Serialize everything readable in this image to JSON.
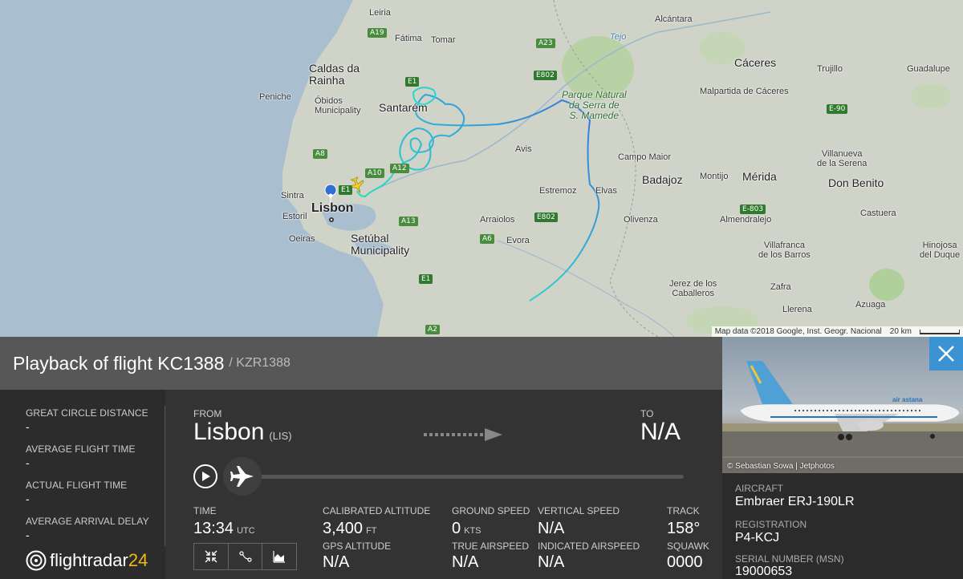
{
  "map": {
    "places": {
      "leiria": "Leiria",
      "fatima": "Fátima",
      "tomar": "Tomar",
      "caldas": "Caldas da\nRainha",
      "peniche": "Peniche",
      "obidos": "Óbidos\nMunicipality",
      "santarem": "Santarém",
      "sintra": "Sintra",
      "estoril": "Estoril",
      "oeiras": "Oeiras",
      "lisbon": "Lisbon",
      "setubal": "Setúbal\nMunicipality",
      "avis": "Avis",
      "estremoz": "Estremoz",
      "arraiolos": "Arraiolos",
      "evora": "Evora",
      "elvas": "Elvas",
      "campo_maior": "Campo Maior",
      "badajoz": "Badajoz",
      "olivenza": "Olivenza",
      "montijo": "Montijo",
      "merida": "Mérida",
      "caceres": "Cáceres",
      "malpartida": "Malpartida de Cáceres",
      "trujillo": "Trujillo",
      "alcantara": "Alcántara",
      "guadalupe": "Guadalupe",
      "villanueva": "Villanueva\nde la Serena",
      "don_benito": "Don Benito",
      "almendralejo": "Almendralejo",
      "castuera": "Castuera",
      "villafranca": "Villafranca\nde los Barros",
      "hinojosa": "Hinojosa\ndel Duque",
      "jerez": "Jerez de los\nCaballeros",
      "llerena": "Llerena",
      "azuaga": "Azuaga",
      "zafra": "Zafra",
      "park": "Parque Natural\nda Serra de\nS. Mamede",
      "tejo": "Tejo"
    },
    "roads": [
      "A19",
      "A23",
      "E802",
      "E1",
      "A8",
      "A10",
      "A12",
      "A13",
      "A6",
      "E802",
      "E1",
      "A2",
      "E1",
      "E-90",
      "E-803"
    ],
    "attribution": "Map data ©2018 Google, Inst. Geogr. Nacional",
    "scale": "20 km"
  },
  "header": {
    "title": "Playback of flight KC1388",
    "subtitle": "/ KZR1388"
  },
  "left_stats": [
    {
      "label": "GREAT CIRCLE DISTANCE",
      "value": "-"
    },
    {
      "label": "AVERAGE FLIGHT TIME",
      "value": "-"
    },
    {
      "label": "ACTUAL FLIGHT TIME",
      "value": "-"
    },
    {
      "label": "AVERAGE ARRIVAL DELAY",
      "value": "-"
    }
  ],
  "logo": {
    "text": "flightradar",
    "num": "24"
  },
  "route": {
    "from_label": "FROM",
    "from_city": "Lisbon",
    "from_code": "(LIS)",
    "to_label": "TO",
    "to_value": "N/A"
  },
  "telemetry": {
    "time": {
      "label": "TIME",
      "value": "13:34",
      "unit": "UTC"
    },
    "cal_alt": {
      "label": "CALIBRATED ALTITUDE",
      "value": "3,400",
      "unit": "FT"
    },
    "gps_alt": {
      "label": "GPS ALTITUDE",
      "value": "N/A"
    },
    "ground_speed": {
      "label": "GROUND SPEED",
      "value": "0",
      "unit": "KTS"
    },
    "true_airspeed": {
      "label": "TRUE AIRSPEED",
      "value": "N/A"
    },
    "vertical_speed": {
      "label": "VERTICAL SPEED",
      "value": "N/A"
    },
    "indicated_airspeed": {
      "label": "INDICATED AIRSPEED",
      "value": "N/A"
    },
    "track": {
      "label": "TRACK",
      "value": "158°"
    },
    "squawk": {
      "label": "SQUAWK",
      "value": "0000"
    }
  },
  "aircraft": {
    "photo_credit": "© Sebastian Sowa | Jetphotos",
    "aircraft_label": "AIRCRAFT",
    "aircraft_value": "Embraer ERJ-190LR",
    "registration_label": "REGISTRATION",
    "registration_value": "P4-KCJ",
    "serial_label": "SERIAL NUMBER (MSN)",
    "serial_value": "19000653",
    "livery_text": "air astana"
  },
  "colors": {
    "accent": "#3c93d3",
    "logo_num": "#f0b81c",
    "track_start": "#23e87a",
    "track_end": "#3a6fe0"
  }
}
